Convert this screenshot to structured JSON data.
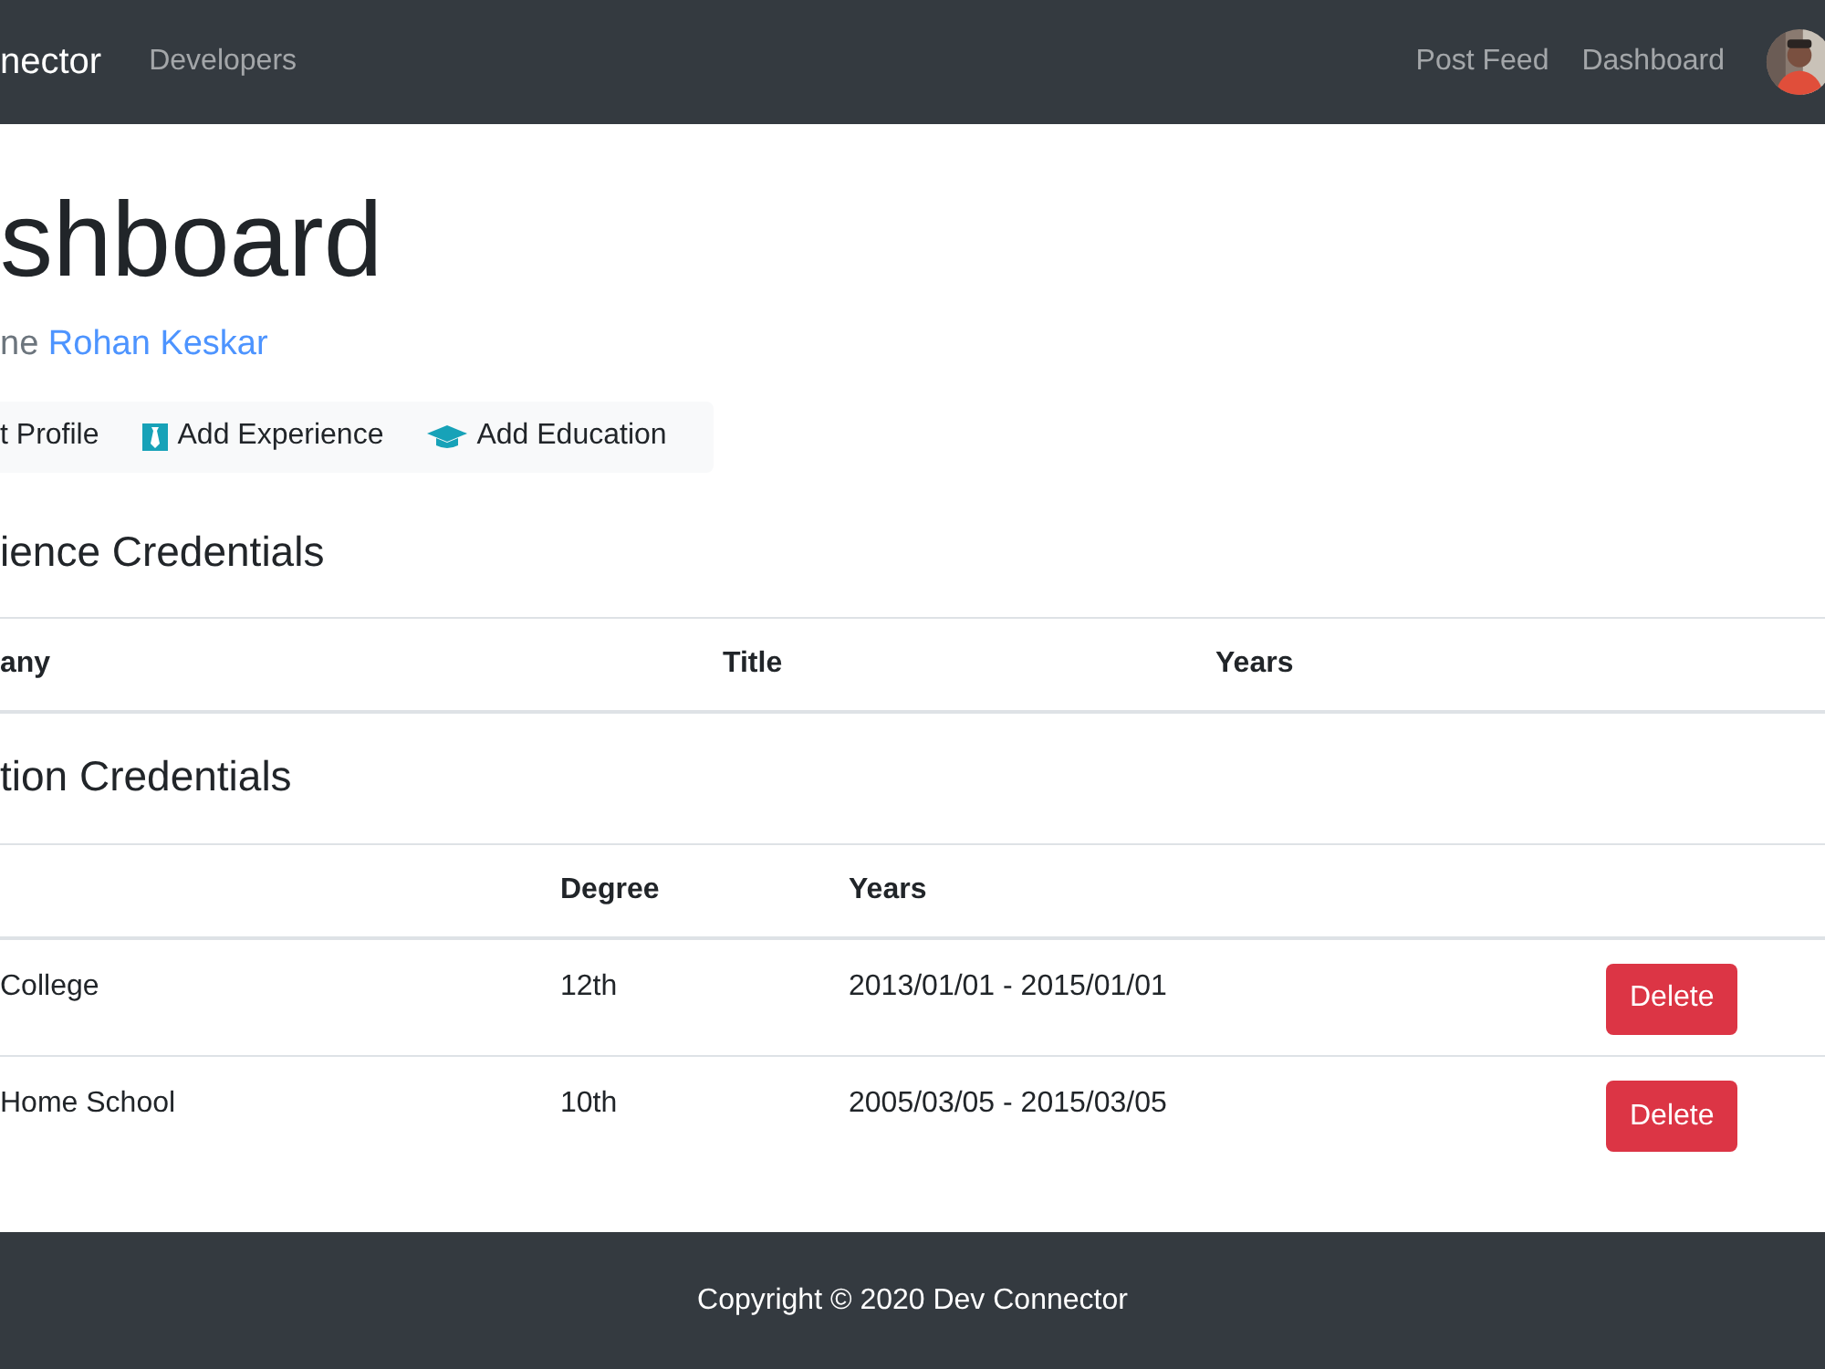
{
  "navbar": {
    "brand": "nector",
    "links_left": [
      "Developers"
    ],
    "links_right": [
      "Post Feed",
      "Dashboard"
    ],
    "avatar": {
      "kind": "picture"
    }
  },
  "page_title": "shboard",
  "welcome": {
    "prefix": "ne",
    "user_link": "Rohan Keskar"
  },
  "actions": [
    {
      "label": "t Profile",
      "kind": "profile"
    },
    {
      "label": "Add Experience",
      "kind": "experience"
    },
    {
      "label": "Add Education",
      "kind": "education"
    }
  ],
  "experience": {
    "heading": "ience Credentials",
    "columns": [
      "any",
      "Title",
      "Years"
    ]
  },
  "education": {
    "heading": "tion Credentials",
    "columns": [
      "Degree",
      "Years"
    ],
    "rows": [
      {
        "school": "College",
        "degree": "12th",
        "years": "2013/01/01 - 2015/01/01",
        "action": "Delete"
      },
      {
        "school": "Home School",
        "degree": "10th",
        "years": "2005/03/05 - 2015/03/05",
        "action": "Delete"
      }
    ]
  },
  "footer": "Copyright © 2020 Dev Connector"
}
